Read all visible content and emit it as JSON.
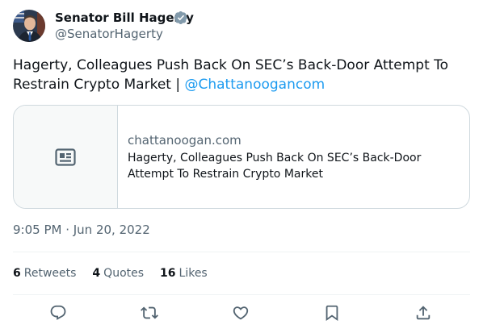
{
  "author": {
    "name": "Senator Bill Hagerty",
    "handle": "@SenatorHagerty"
  },
  "tweet": {
    "text": "Hagerty, Colleagues Push Back On SEC’s Back-Door Attempt To Restrain Crypto Market | ",
    "mention": "@Chattanoogancom",
    "timestamp": "9:05 PM · Jun 20, 2022"
  },
  "card": {
    "domain": "chattanoogan.com",
    "title": "Hagerty, Colleagues Push Back On SEC’s Back-Door Attempt To Restrain Crypto Market",
    "thumbnail_icon": "news-article-icon"
  },
  "stats": {
    "retweets_count": "6",
    "retweets_label": "Retweets",
    "quotes_count": "4",
    "quotes_label": "Quotes",
    "likes_count": "16",
    "likes_label": "Likes"
  },
  "actions": [
    "reply-icon",
    "retweet-icon",
    "like-icon",
    "bookmark-icon",
    "share-icon"
  ],
  "colors": {
    "accent": "#1d9bf0",
    "text_primary": "#0f1419",
    "text_secondary": "#536471",
    "border": "#cfd9de"
  }
}
